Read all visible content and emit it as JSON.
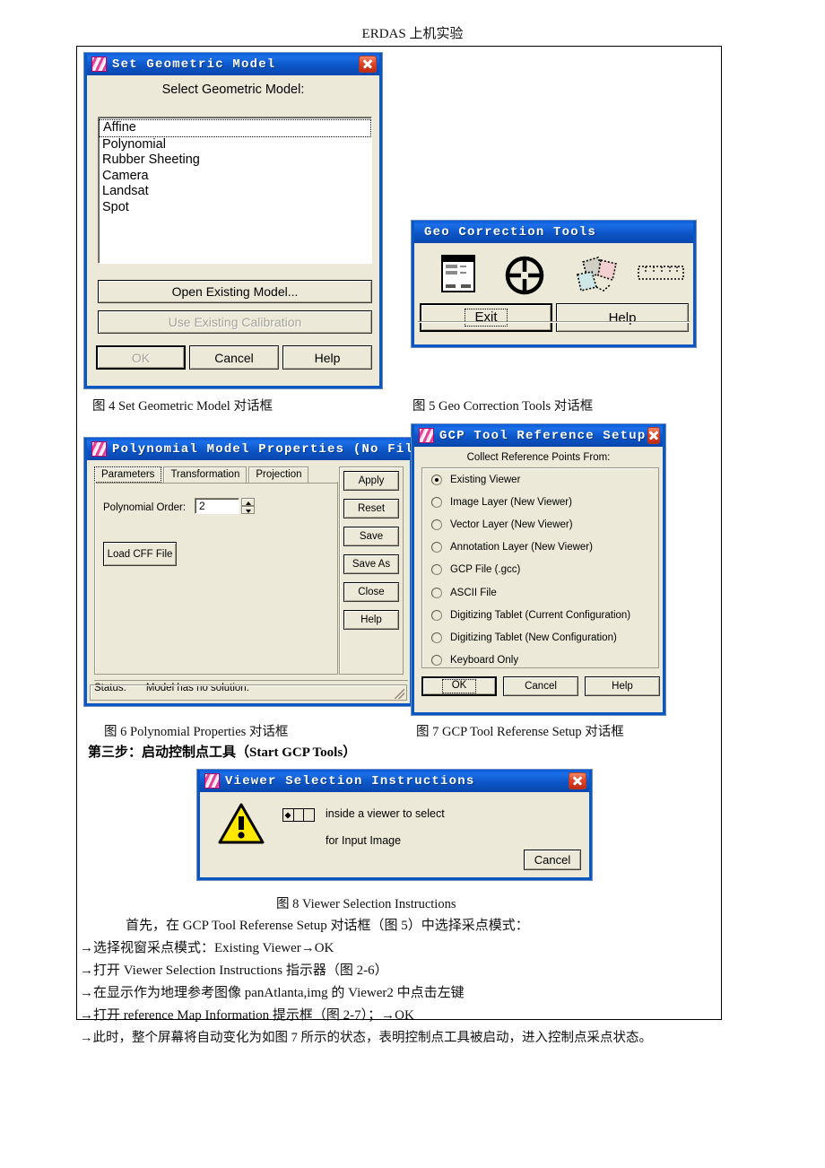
{
  "page": {
    "header": "ERDAS 上机实验"
  },
  "dialog_set_geometric_model": {
    "title": "Set Geometric Model",
    "icon": "erdas-app-icon",
    "close_icon": "close-icon",
    "prompt": "Select Geometric Model:",
    "list_items": [
      "Affine",
      "Polynomial",
      "Rubber Sheeting",
      "Camera",
      "Landsat",
      "Spot"
    ],
    "selected_item": "Affine",
    "open_existing_model": "Open Existing Model...",
    "use_existing_calibration": "Use Existing Calibration",
    "ok": "OK",
    "cancel": "Cancel",
    "help": "Help"
  },
  "dialog_geo_correction_tools": {
    "title": "Geo Correction Tools",
    "icons": [
      "model-properties-icon",
      "gcp-crosshair-icon",
      "resample-polygons-icon",
      "grid-strip-icon"
    ],
    "exit": "Exit",
    "help": "Help"
  },
  "dialog_polynomial_properties": {
    "title": "Polynomial Model Properties (No File)",
    "minimize_icon": "minimize-icon",
    "maximize_icon": "maximize-icon",
    "close_icon": "close-icon",
    "tabs": [
      "Parameters",
      "Transformation",
      "Projection"
    ],
    "active_tab": "Parameters",
    "order_label": "Polynomial Order:",
    "order_value": "2",
    "load_cff": "Load CFF File",
    "status_label": "Status:",
    "status_value": "Model has no solution.",
    "side_buttons": [
      "Apply",
      "Reset",
      "Save",
      "Save As",
      "Close",
      "Help"
    ]
  },
  "dialog_gcp_tool_reference_setup": {
    "title": "GCP Tool Reference Setup",
    "close_icon": "close-icon",
    "heading": "Collect Reference Points From:",
    "options": [
      "Existing Viewer",
      "Image Layer (New Viewer)",
      "Vector Layer (New Viewer)",
      "Annotation Layer (New Viewer)",
      "GCP File (.gcc)",
      "ASCII File",
      "Digitizing Tablet (Current Configuration)",
      "Digitizing Tablet (New Configuration)",
      "Keyboard Only"
    ],
    "selected_index": 0,
    "ok": "OK",
    "cancel": "Cancel",
    "help": "Help"
  },
  "dialog_viewer_selection_instructions": {
    "title": "Viewer Selection Instructions",
    "close_icon": "close-icon",
    "warning_icon": "warning-triangle-icon",
    "mouse_icon": "left-mouse-button-icon",
    "line1": "inside a viewer to select",
    "line2": "for Input Image",
    "cancel": "Cancel"
  },
  "captions": {
    "fig4": "图 4 Set Geometric Model 对话框",
    "fig5": "图 5 Geo Correction Tools 对话框",
    "fig6": "图 6   Polynomial Properties 对话框",
    "fig7": "图 7   GCP Tool Referense Setup  对话框",
    "fig8": "图 8 Viewer Selection Instructions",
    "step3": "第三步：启动控制点工具（Start GCP Tools）"
  },
  "body_text": {
    "line1": "首先，在 GCP Tool Referense Setup 对话框（图 5）中选择采点模式：",
    "line2": "→选择视窗采点模式：Existing Viewer→OK",
    "line3": "→打开 Viewer Selection Instructions 指示器（图 2-6）",
    "line4": "→在显示作为地理参考图像 panAtlanta,img 的 Viewer2 中点击左键",
    "line5": "→打开 reference Map Information  提示框（图 2-7）；→OK",
    "line6": "→此时，整个屏幕将自动变化为如图 7 所示的状态，表明控制点工具被启动，进入控制点采点状态。"
  }
}
